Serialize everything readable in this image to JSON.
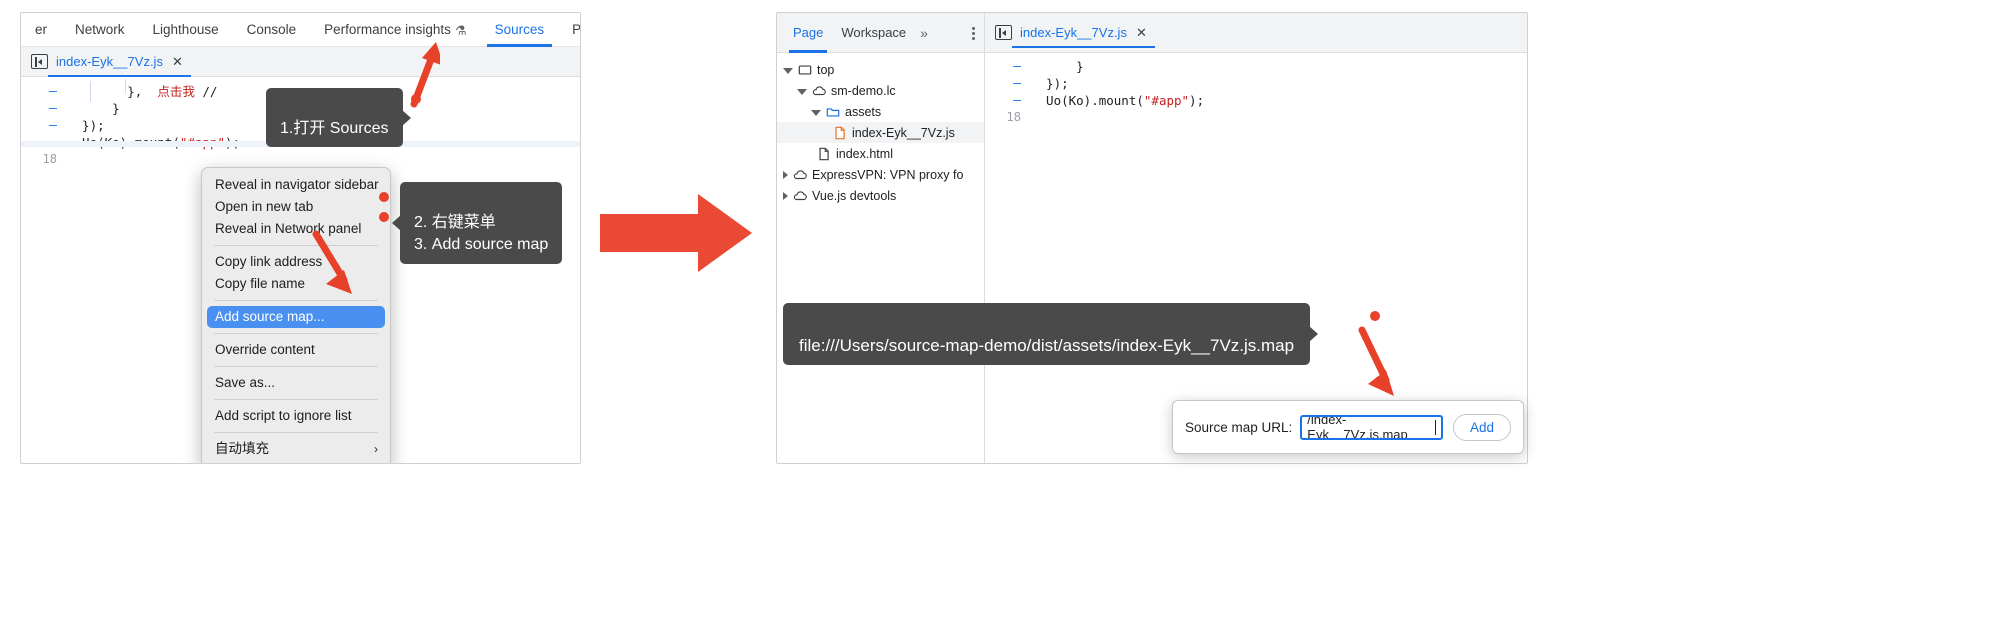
{
  "left_panel": {
    "devtools_tabs": [
      {
        "label": "er",
        "active": false
      },
      {
        "label": "Network",
        "active": false
      },
      {
        "label": "Lighthouse",
        "active": false
      },
      {
        "label": "Console",
        "active": false
      },
      {
        "label": "Performance insights",
        "active": false,
        "icon": "flask-icon"
      },
      {
        "label": "Sources",
        "active": true
      },
      {
        "label": "Performa",
        "active": false
      }
    ],
    "file_tab": {
      "name": "index-Eyk__7Vz.js",
      "close": "✕"
    },
    "code_lines": [
      {
        "gutter": "–",
        "text": "        },  // 点击我 //"
      },
      {
        "gutter": "–",
        "text": "      }"
      },
      {
        "gutter": "–",
        "text": "  });"
      },
      {
        "gutter": "–",
        "text": "  Uo(Ko).mount(\"#app\");"
      },
      {
        "gutter": "18",
        "text": ""
      }
    ],
    "code_tokens": {
      "comment_cn": "点击我",
      "string_app": "\"#app\""
    },
    "context_menu": [
      {
        "label": "Reveal in navigator sidebar",
        "type": "item"
      },
      {
        "label": "Open in new tab",
        "type": "item"
      },
      {
        "label": "Reveal in Network panel",
        "type": "item"
      },
      {
        "type": "separator"
      },
      {
        "label": "Copy link address",
        "type": "item"
      },
      {
        "label": "Copy file name",
        "type": "item"
      },
      {
        "type": "separator"
      },
      {
        "label": "Add source map...",
        "type": "item",
        "selected": true
      },
      {
        "type": "separator"
      },
      {
        "label": "Override content",
        "type": "item"
      },
      {
        "type": "separator"
      },
      {
        "label": "Save as...",
        "type": "item"
      },
      {
        "type": "separator"
      },
      {
        "label": "Add script to ignore list",
        "type": "item"
      },
      {
        "type": "separator"
      },
      {
        "label": "自动填充",
        "type": "item",
        "submenu": "›"
      }
    ]
  },
  "annotations": {
    "tip_1": "1.打开 Sources",
    "tip_2": "2. 右键菜单\n3. Add source map",
    "tip_url": "file:///Users/source-map-demo/dist/assets/index-Eyk__7Vz.js.map"
  },
  "right_panel": {
    "nav_tabs": [
      {
        "label": "Page",
        "active": true
      },
      {
        "label": "Workspace",
        "active": false
      }
    ],
    "nav_overflow": "»",
    "tree": [
      {
        "label": "top",
        "depth": 0,
        "icon": "frame-icon",
        "expanded": true,
        "selected": false
      },
      {
        "label": "sm-demo.lc",
        "depth": 1,
        "icon": "cloud-icon",
        "expanded": true,
        "selected": false
      },
      {
        "label": "assets",
        "depth": 2,
        "icon": "folder-icon",
        "expanded": true,
        "selected": false
      },
      {
        "label": "index-Eyk__7Vz.js",
        "depth": 3,
        "icon": "js-file-icon",
        "expanded": null,
        "selected": true
      },
      {
        "label": "index.html",
        "depth": 2,
        "icon": "html-file-icon",
        "expanded": null,
        "selected": false
      },
      {
        "label": "ExpressVPN: VPN proxy fo",
        "depth": 0,
        "icon": "cloud-icon",
        "expanded": false,
        "selected": false
      },
      {
        "label": "Vue.js devtools",
        "depth": 0,
        "icon": "cloud-icon",
        "expanded": false,
        "selected": false
      }
    ],
    "file_tab": {
      "name": "index-Eyk__7Vz.js",
      "close": "✕"
    },
    "code_lines": [
      {
        "gutter": "–",
        "text": "      }"
      },
      {
        "gutter": "–",
        "text": "  });"
      },
      {
        "gutter": "–",
        "text": "  Uo(Ko).mount(\"#app\");"
      },
      {
        "gutter": "18",
        "text": ""
      }
    ],
    "code_tokens": {
      "string_app": "\"#app\""
    }
  },
  "source_map_dialog": {
    "label": "Source map URL:",
    "input_value": "/index-Eyk__7Vz.js.map",
    "input_placeholder": "Source map URL",
    "add_button": "Add"
  },
  "colors": {
    "accent_blue": "#1a73e8",
    "arrow_red": "#e8412a",
    "menu_highlight": "#4a90f0",
    "tooltip_bg": "#4a4a4a",
    "string_red": "#c5221f"
  }
}
